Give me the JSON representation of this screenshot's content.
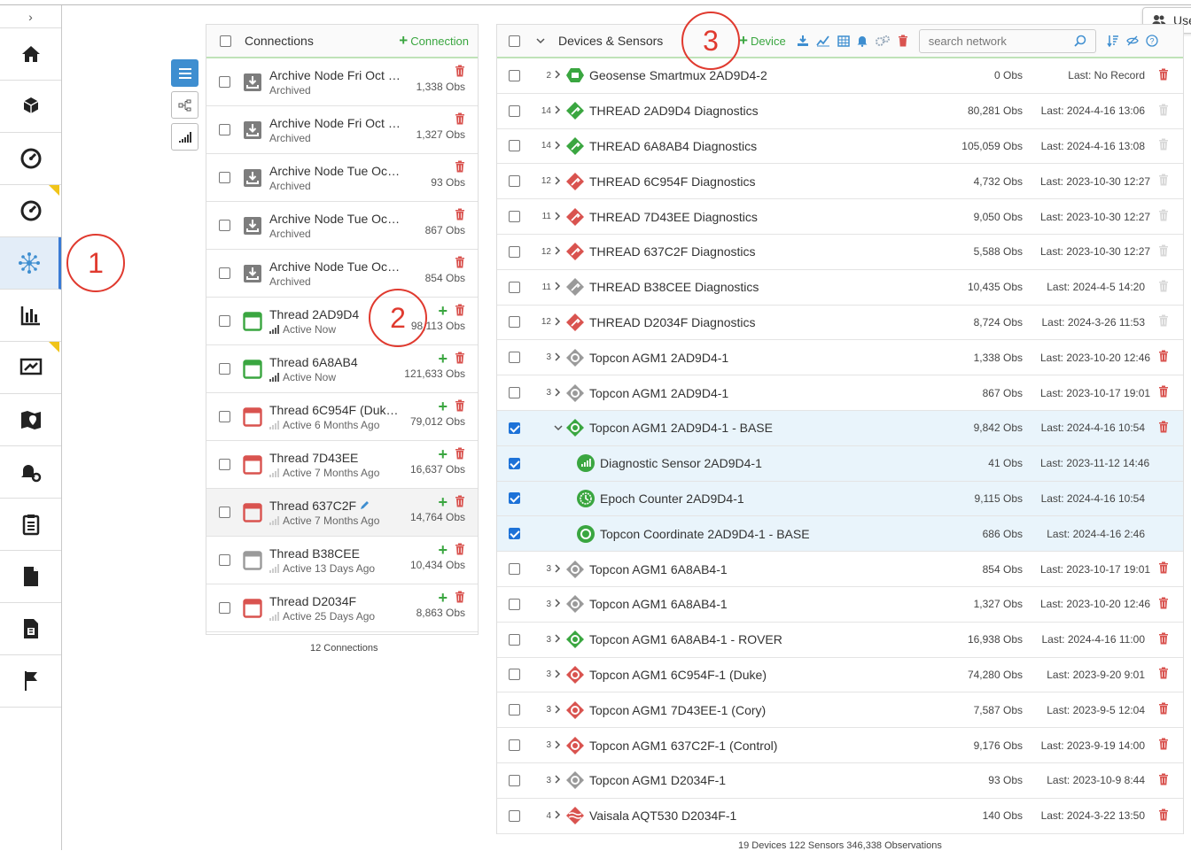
{
  "sidebar": {
    "collapse_glyph": "›",
    "items": [
      {
        "icon": "home-icon"
      },
      {
        "icon": "cube-icon"
      },
      {
        "icon": "gauge-icon"
      },
      {
        "icon": "gauge-alert-icon",
        "badge": true
      },
      {
        "icon": "network-icon",
        "active": true
      },
      {
        "icon": "bar-chart-icon"
      },
      {
        "icon": "chart-share-icon",
        "badge": true
      },
      {
        "icon": "map-icon"
      },
      {
        "icon": "bell-settings-icon"
      },
      {
        "icon": "clipboard-icon"
      },
      {
        "icon": "document-icon"
      },
      {
        "icon": "document-alt-icon"
      },
      {
        "icon": "flag-icon"
      }
    ]
  },
  "annotations": {
    "one": "1",
    "two": "2",
    "three": "3"
  },
  "connections": {
    "title": "Connections",
    "add_label": "Connection",
    "footer": "12 Connections",
    "rows": [
      {
        "name": "Archive Node Fri Oct …",
        "status": "Archived",
        "obs": "1,338 Obs",
        "kind": "archive",
        "add": false,
        "bars": "none"
      },
      {
        "name": "Archive Node Fri Oct …",
        "status": "Archived",
        "obs": "1,327 Obs",
        "kind": "archive",
        "add": false,
        "bars": "none"
      },
      {
        "name": "Archive Node Tue Oct …",
        "status": "Archived",
        "obs": "93 Obs",
        "kind": "archive",
        "add": false,
        "bars": "none"
      },
      {
        "name": "Archive Node Tue Oct …",
        "status": "Archived",
        "obs": "867 Obs",
        "kind": "archive",
        "add": false,
        "bars": "none"
      },
      {
        "name": "Archive Node Tue Oct …",
        "status": "Archived",
        "obs": "854 Obs",
        "kind": "archive",
        "add": false,
        "bars": "none"
      },
      {
        "name": "Thread 2AD9D4",
        "status": "Active Now",
        "obs": "98,113 Obs",
        "kind": "green",
        "add": true,
        "bars": "full"
      },
      {
        "name": "Thread 6A8AB4",
        "status": "Active Now",
        "obs": "121,633 Obs",
        "kind": "green",
        "add": true,
        "bars": "full"
      },
      {
        "name": "Thread 6C954F (Duke…",
        "status": "Active 6 Months Ago",
        "obs": "79,012 Obs",
        "kind": "red",
        "add": true,
        "bars": "dim"
      },
      {
        "name": "Thread 7D43EE",
        "status": "Active 7 Months Ago",
        "obs": "16,637 Obs",
        "kind": "red",
        "add": true,
        "bars": "dim"
      },
      {
        "name": "Thread 637C2F",
        "status": "Active 7 Months Ago",
        "obs": "14,764 Obs",
        "kind": "red",
        "add": true,
        "bars": "dim",
        "edit": true,
        "highlight": true
      },
      {
        "name": "Thread B38CEE",
        "status": "Active 13 Days Ago",
        "obs": "10,434 Obs",
        "kind": "gray",
        "add": true,
        "bars": "dim"
      },
      {
        "name": "Thread D2034F",
        "status": "Active 25 Days Ago",
        "obs": "8,863 Obs",
        "kind": "red",
        "add": true,
        "bars": "dim"
      }
    ]
  },
  "devices": {
    "title": "Devices & Sensors",
    "add_label": "Device",
    "search_placeholder": "search network",
    "footer": "19 Devices   122 Sensors   346,338 Observations",
    "rows": [
      {
        "count": "2",
        "name": "Geosense Smartmux 2AD9D4-2",
        "obs": "0 Obs",
        "last": "Last: No Record",
        "icon": "green-hex",
        "trash": "red"
      },
      {
        "count": "14",
        "name": "THREAD 2AD9D4 Diagnostics",
        "obs": "80,281 Obs",
        "last": "Last: 2024-4-16 13:06",
        "icon": "green-diamond",
        "trash": "light"
      },
      {
        "count": "14",
        "name": "THREAD 6A8AB4 Diagnostics",
        "obs": "105,059 Obs",
        "last": "Last: 2024-4-16 13:08",
        "icon": "green-diamond",
        "trash": "light"
      },
      {
        "count": "12",
        "name": "THREAD 6C954F Diagnostics",
        "obs": "4,732 Obs",
        "last": "Last: 2023-10-30 12:27",
        "icon": "red-diamond",
        "trash": "light"
      },
      {
        "count": "11",
        "name": "THREAD 7D43EE Diagnostics",
        "obs": "9,050 Obs",
        "last": "Last: 2023-10-30 12:27",
        "icon": "red-diamond",
        "trash": "light"
      },
      {
        "count": "12",
        "name": "THREAD 637C2F Diagnostics",
        "obs": "5,588 Obs",
        "last": "Last: 2023-10-30 12:27",
        "icon": "red-diamond",
        "trash": "light"
      },
      {
        "count": "11",
        "name": "THREAD B38CEE Diagnostics",
        "obs": "10,435 Obs",
        "last": "Last: 2024-4-5 14:20",
        "icon": "gray-diamond",
        "trash": "light"
      },
      {
        "count": "12",
        "name": "THREAD D2034F Diagnostics",
        "obs": "8,724 Obs",
        "last": "Last: 2024-3-26 11:53",
        "icon": "red-diamond",
        "trash": "light"
      },
      {
        "count": "3",
        "name": "Topcon AGM1 2AD9D4-1",
        "obs": "1,338 Obs",
        "last": "Last: 2023-10-20 12:46",
        "icon": "gray-ring",
        "trash": "red"
      },
      {
        "count": "3",
        "name": "Topcon AGM1 2AD9D4-1",
        "obs": "867 Obs",
        "last": "Last: 2023-10-17 19:01",
        "icon": "gray-ring",
        "trash": "red"
      },
      {
        "count": "",
        "name": "Topcon AGM1 2AD9D4-1 - BASE",
        "obs": "9,842 Obs",
        "last": "Last: 2024-4-16 10:54",
        "icon": "green-ring",
        "trash": "red",
        "selected": true,
        "expanded": true
      },
      {
        "count": "",
        "name": "Diagnostic Sensor 2AD9D4-1",
        "obs": "41 Obs",
        "last": "Last: 2023-11-12 14:46",
        "icon": "sensor-bars",
        "trash": "none",
        "selected": true,
        "child": true
      },
      {
        "count": "",
        "name": "Epoch Counter 2AD9D4-1",
        "obs": "9,115 Obs",
        "last": "Last: 2024-4-16 10:54",
        "icon": "sensor-clock",
        "trash": "none",
        "selected": true,
        "child": true
      },
      {
        "count": "",
        "name": "Topcon Coordinate 2AD9D4-1 - BASE",
        "obs": "686 Obs",
        "last": "Last: 2024-4-16 2:46",
        "icon": "sensor-ring",
        "trash": "none",
        "selected": true,
        "child": true
      },
      {
        "count": "3",
        "name": "Topcon AGM1 6A8AB4-1",
        "obs": "854 Obs",
        "last": "Last: 2023-10-17 19:01",
        "icon": "gray-ring",
        "trash": "red"
      },
      {
        "count": "3",
        "name": "Topcon AGM1 6A8AB4-1",
        "obs": "1,327 Obs",
        "last": "Last: 2023-10-20 12:46",
        "icon": "gray-ring",
        "trash": "red"
      },
      {
        "count": "3",
        "name": "Topcon AGM1 6A8AB4-1 - ROVER",
        "obs": "16,938 Obs",
        "last": "Last: 2024-4-16 11:00",
        "icon": "green-ring",
        "trash": "red"
      },
      {
        "count": "3",
        "name": "Topcon AGM1 6C954F-1 (Duke)",
        "obs": "74,280 Obs",
        "last": "Last: 2023-9-20 9:01",
        "icon": "red-ring",
        "trash": "red"
      },
      {
        "count": "3",
        "name": "Topcon AGM1 7D43EE-1 (Cory)",
        "obs": "7,587 Obs",
        "last": "Last: 2023-9-5 12:04",
        "icon": "red-ring",
        "trash": "red"
      },
      {
        "count": "3",
        "name": "Topcon AGM1 637C2F-1 (Control)",
        "obs": "9,176 Obs",
        "last": "Last: 2023-9-19 14:00",
        "icon": "red-ring",
        "trash": "red"
      },
      {
        "count": "3",
        "name": "Topcon AGM1 D2034F-1",
        "obs": "93 Obs",
        "last": "Last: 2023-10-9 8:44",
        "icon": "gray-ring",
        "trash": "red"
      },
      {
        "count": "4",
        "name": "Vaisala AQT530 D2034F-1",
        "obs": "140 Obs",
        "last": "Last: 2024-3-22 13:50",
        "icon": "red-wave",
        "trash": "red"
      }
    ]
  },
  "user_button": {
    "label": "Use"
  },
  "colors": {
    "green": "#3aa640",
    "red": "#d9534f",
    "gray": "#9a9a9a",
    "blue": "#3e8ed0",
    "annotation": "#e03a2f"
  }
}
